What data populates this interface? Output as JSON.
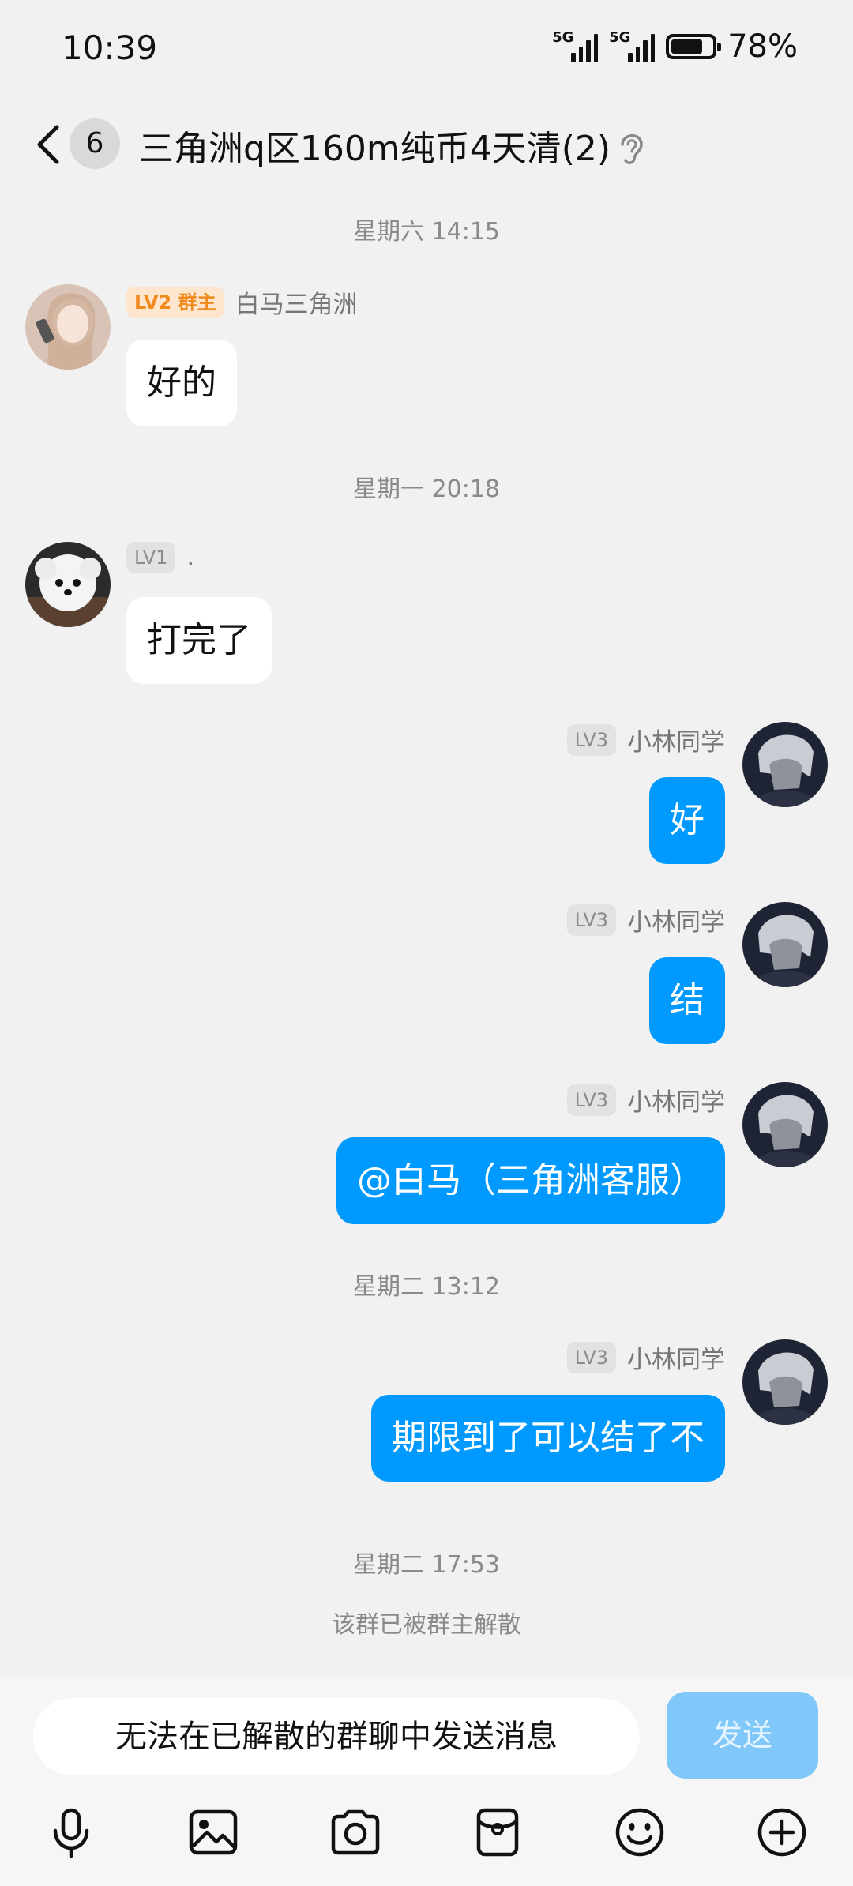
{
  "status_bar": {
    "time": "10:39",
    "network_1": "5G",
    "network_2": "5G",
    "battery_percent": "78%",
    "battery_level": 0.78
  },
  "header": {
    "unread_count": "6",
    "title": "三角洲q区160m纯币4天清(2)"
  },
  "messages": [
    {
      "type": "time",
      "text": "星期六 14:15"
    },
    {
      "type": "msg",
      "side": "left",
      "level": "LV2 群主",
      "name": "白马三角洲",
      "text": "好的"
    },
    {
      "type": "time",
      "text": "星期一 20:18"
    },
    {
      "type": "msg",
      "side": "left",
      "level": "LV1",
      "name": ".",
      "text": "打完了"
    },
    {
      "type": "msg",
      "side": "right",
      "level": "LV3",
      "name": "小林同学",
      "text": "好"
    },
    {
      "type": "msg",
      "side": "right",
      "level": "LV3",
      "name": "小林同学",
      "text": "结"
    },
    {
      "type": "msg",
      "side": "right",
      "level": "LV3",
      "name": "小林同学",
      "text": "@白马（三角洲客服）"
    },
    {
      "type": "time",
      "text": "星期二 13:12"
    },
    {
      "type": "msg",
      "side": "right",
      "level": "LV3",
      "name": "小林同学",
      "text": "期限到了可以结了不"
    },
    {
      "type": "time",
      "text": "星期二 17:53"
    },
    {
      "type": "system",
      "text": "该群已被群主解散"
    }
  ],
  "input": {
    "placeholder": "无法在已解散的群聊中发送消息",
    "send_label": "发送"
  },
  "toolbar": {
    "icons": [
      "microphone-icon",
      "image-icon",
      "camera-icon",
      "red-packet-icon",
      "emoji-icon",
      "plus-icon"
    ]
  },
  "colors": {
    "accent": "#0099ff",
    "background": "#f1f1f1",
    "owner_badge": "#f08a1c"
  }
}
